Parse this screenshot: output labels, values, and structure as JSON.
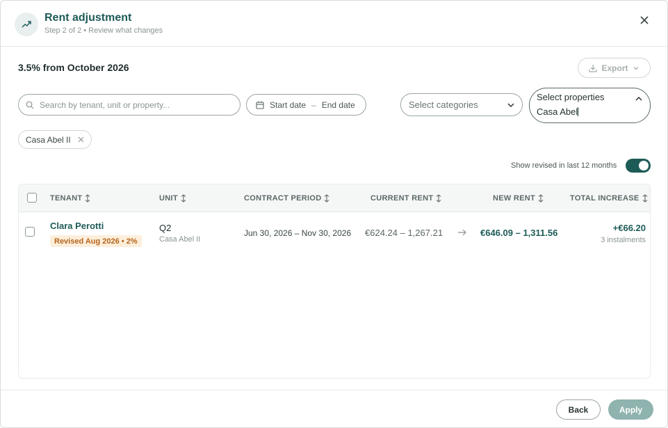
{
  "header": {
    "title": "Rent adjustment",
    "subtitle": "Step 2 of 2 • Review what changes",
    "icon": "trending-up-icon"
  },
  "summary": {
    "title": "3.5% from October 2026",
    "export_label": "Export"
  },
  "filters": {
    "search_placeholder": "Search by tenant, unit or property...",
    "start_date": "Start date",
    "date_separator": "–",
    "end_date": "End date",
    "categories_placeholder": "Select categories",
    "properties_placeholder": "Select properties",
    "properties_typed": "Casa Abel",
    "chip_label": "Casa Abel II"
  },
  "toggle": {
    "label": "Show revised in last 12 months",
    "on": true
  },
  "table": {
    "columns": [
      "TENANT",
      "UNIT",
      "CONTRACT PERIOD",
      "CURRENT RENT",
      "NEW RENT",
      "TOTAL INCREASE"
    ],
    "rows": [
      {
        "tenant": "Clara Perotti",
        "badge": "Revised Aug 2026 • 2%",
        "unit": "Q2",
        "property": "Casa Abel II",
        "period": "Jun 30, 2026 – Nov 30, 2026",
        "current_rent": "€624.24 – 1,267.21",
        "new_rent": "€646.09 – 1,311.56",
        "increase": "+€66.20",
        "instalments": "3 instalments"
      }
    ]
  },
  "footer": {
    "back_label": "Back",
    "apply_label": "Apply"
  },
  "colors": {
    "brand": "#1d5b57",
    "badge_bg": "#fdeedb",
    "badge_text": "#b5651d",
    "apply_disabled": "#8fb3af"
  }
}
